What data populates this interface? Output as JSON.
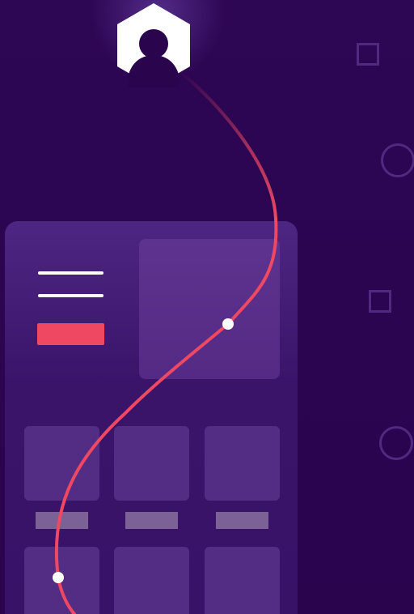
{
  "illustration": {
    "accent_color": "#ee4862",
    "background_color": "#2b0550",
    "card_color": "#3e186d",
    "tile_color": "#532c84",
    "icons": [
      "user-hexagon-icon",
      "square-outline-icon",
      "circle-outline-icon"
    ]
  }
}
